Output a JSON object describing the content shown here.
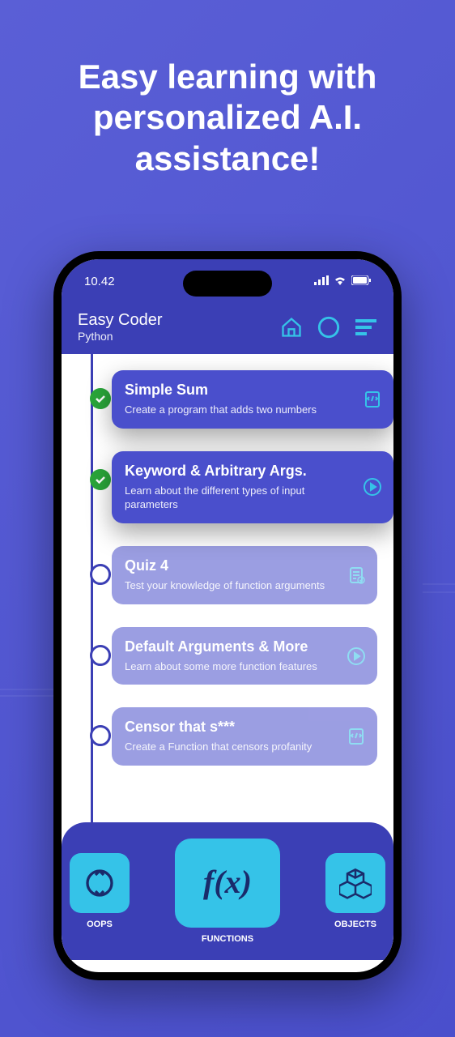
{
  "hero": "Easy learning with personalized A.I. assistance!",
  "status": {
    "time": "10.42"
  },
  "header": {
    "app_name": "Easy Coder",
    "language": "Python"
  },
  "lessons": [
    {
      "title": "Simple Sum",
      "sub": "Create a program that adds two numbers",
      "done": true,
      "icon": "code",
      "pop": true
    },
    {
      "title": "Keyword & Arbitrary Args.",
      "sub": "Learn about the different types of input parameters",
      "done": true,
      "icon": "play",
      "pop": true
    },
    {
      "title": "Quiz 4",
      "sub": "Test your knowledge of function arguments",
      "done": false,
      "icon": "quiz",
      "faded": true
    },
    {
      "title": "Default Arguments & More",
      "sub": "Learn about some more function features",
      "done": false,
      "icon": "play",
      "faded": true
    },
    {
      "title": "Censor that s***",
      "sub": "Create a Function that censors profanity",
      "done": false,
      "icon": "code",
      "faded": true
    }
  ],
  "nav": {
    "left": "OOPS",
    "center": "FUNCTIONS",
    "right": "OBJECTS"
  }
}
